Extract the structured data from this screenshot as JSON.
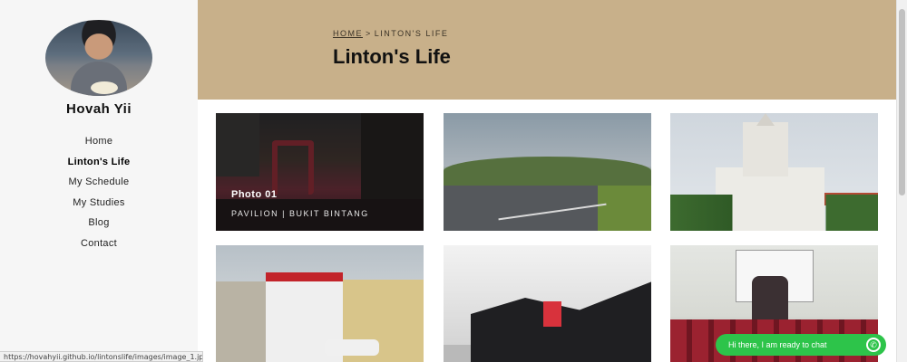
{
  "profile": {
    "name": "Hovah Yii"
  },
  "nav": {
    "items": [
      {
        "label": "Home"
      },
      {
        "label": "Linton's Life"
      },
      {
        "label": "My Schedule"
      },
      {
        "label": "My Studies"
      },
      {
        "label": "Blog"
      },
      {
        "label": "Contact"
      }
    ],
    "active_index": 1
  },
  "header": {
    "breadcrumb_home": "HOME",
    "breadcrumb_sep": ">",
    "breadcrumb_current": "LINTON'S LIFE",
    "title": "Linton's Life",
    "color": "#c8b08a"
  },
  "gallery": {
    "items": [
      {
        "title": "Photo 01",
        "subtitle": "PAVILION | BUKIT BINTANG"
      }
    ]
  },
  "status_url": "https://hovahyii.github.io/lintonslife/images/image_1.jpg",
  "chat": {
    "label": "Hi there, I am ready to chat",
    "color": "#2dc44a",
    "icon": "whatsapp-icon"
  }
}
